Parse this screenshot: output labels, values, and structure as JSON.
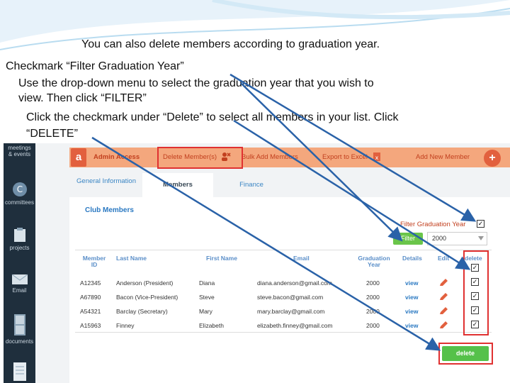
{
  "colors": {
    "arrow": "#2a62a8",
    "red_box": "#e03131",
    "green": "#55c14a",
    "sidebar": "#1f2f3d",
    "accent": "#e2603e"
  },
  "instructions": {
    "line1": "You can also delete members according to graduation year.",
    "line2": "Checkmark “Filter Graduation Year”",
    "line3": "Use the drop-down menu to select the graduation year that you wish to",
    "line4": "view.  Then click “FILTER”",
    "line5": "Click the checkmark under “Delete” to select all members in your list.  Click",
    "line6": "“DELETE”"
  },
  "sidebar": {
    "items": [
      {
        "label": "meetings & events",
        "icon": "calendar-icon"
      },
      {
        "label": "committees",
        "icon": "c-circle-icon"
      },
      {
        "label": "projects",
        "icon": "clipboard-icon"
      },
      {
        "label": "Email",
        "icon": "envelope-icon"
      },
      {
        "label": "documents",
        "icon": "cabinet-icon"
      },
      {
        "label": "",
        "icon": "document-icon"
      }
    ]
  },
  "admin_bar": {
    "logo": "a",
    "title": "Admin Access",
    "delete_members": "Delete Member(s)",
    "bulk_add": "Bulk Add Members",
    "export": "Export to Excel",
    "add_new": "Add New Member"
  },
  "tabs": {
    "general": "General Information",
    "members": "Members",
    "finance": "Finance"
  },
  "club_members": "Club Members",
  "filter": {
    "label": "Filter Graduation Year",
    "checked": "✓",
    "button": "Filter",
    "year": "2000"
  },
  "table": {
    "headers": {
      "member_id": "Member ID",
      "last_name": "Last Name",
      "first_name": "First Name",
      "email": "Email",
      "grad_year": "Graduation Year",
      "details": "Details",
      "edit": "Edit",
      "delete": "delete"
    },
    "header_check": "✓",
    "rows": [
      {
        "id": "A12345",
        "last": "Anderson (President)",
        "first": "Diana",
        "email": "diana.anderson@gmail.com",
        "year": "2000",
        "details": "view",
        "check": "✓"
      },
      {
        "id": "A67890",
        "last": "Bacon (Vice-President)",
        "first": "Steve",
        "email": "steve.bacon@gmail.com",
        "year": "2000",
        "details": "view",
        "check": "✓"
      },
      {
        "id": "A54321",
        "last": "Barclay (Secretary)",
        "first": "Mary",
        "email": "mary.barclay@gmail.com",
        "year": "2000",
        "details": "view",
        "check": "✓"
      },
      {
        "id": "A15963",
        "last": "Finney",
        "first": "Elizabeth",
        "email": "elizabeth.finney@gmail.com",
        "year": "2000",
        "details": "view",
        "check": "✓"
      }
    ]
  },
  "delete_button": "delete"
}
